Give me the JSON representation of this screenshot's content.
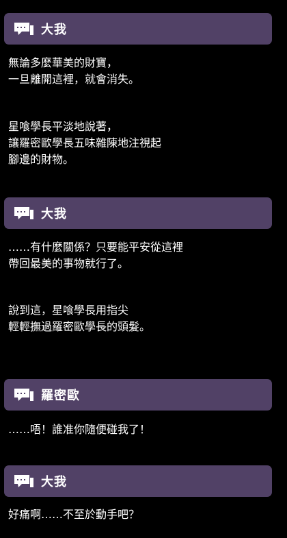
{
  "theme": {
    "background": "#000000",
    "bar": "#514166",
    "text": "#ffffff"
  },
  "icon": "speech-bubble-icon",
  "dialogs": [
    {
      "speaker": "大我"
    },
    {
      "speaker": "大我"
    },
    {
      "speaker": "羅密歐"
    },
    {
      "speaker": "大我"
    }
  ],
  "texts": [
    "無論多麼華美的財寶，\n一旦離開這裡，就會消失。",
    "星喰學長平淡地說著，\n讓羅密歐學長五味雜陳地注視起\n腳邊的財物。",
    "……有什麼關係？只要能平安從這裡\n帶回最美的事物就行了。",
    "說到這，星喰學長用指尖\n輕輕撫過羅密歐學長的頭髮。",
    "……唔！誰准你隨便碰我了！",
    "好痛啊……不至於動手吧？"
  ]
}
